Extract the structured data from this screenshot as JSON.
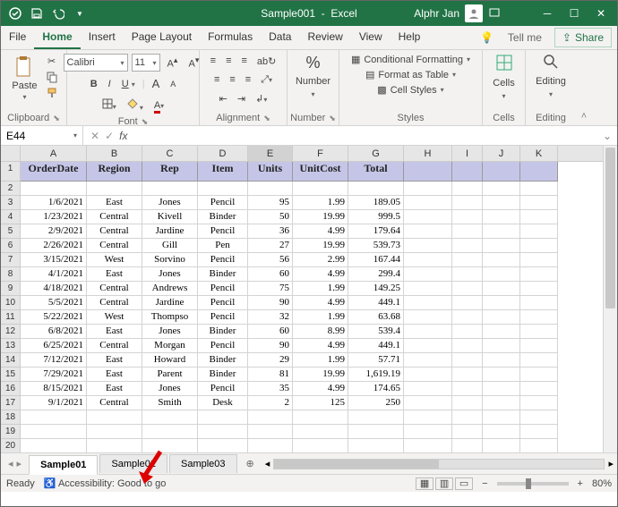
{
  "titlebar": {
    "doc": "Sample001",
    "app": "Excel",
    "user": "Alphr Jan"
  },
  "menu": {
    "file": "File",
    "home": "Home",
    "insert": "Insert",
    "page_layout": "Page Layout",
    "formulas": "Formulas",
    "data": "Data",
    "review": "Review",
    "view": "View",
    "help": "Help",
    "tellme": "Tell me",
    "share": "Share"
  },
  "ribbon": {
    "clipboard": {
      "paste": "Paste",
      "label": "Clipboard"
    },
    "font": {
      "name": "Calibri",
      "size": "11",
      "label": "Font"
    },
    "alignment": {
      "label": "Alignment"
    },
    "number": {
      "btn": "Number",
      "label": "Number"
    },
    "styles": {
      "cond": "Conditional Formatting",
      "table": "Format as Table",
      "cell": "Cell Styles",
      "label": "Styles"
    },
    "cells": {
      "btn": "Cells",
      "label": "Cells"
    },
    "editing": {
      "btn": "Editing",
      "label": "Editing"
    }
  },
  "namebox": "E44",
  "columns": [
    "A",
    "B",
    "C",
    "D",
    "E",
    "F",
    "G",
    "H",
    "I",
    "J",
    "K"
  ],
  "headers": [
    "OrderDate",
    "Region",
    "Rep",
    "Item",
    "Units",
    "UnitCost",
    "Total"
  ],
  "rows": [
    {
      "date": "1/6/2021",
      "region": "East",
      "rep": "Jones",
      "item": "Pencil",
      "units": "95",
      "cost": "1.99",
      "total": "189.05"
    },
    {
      "date": "1/23/2021",
      "region": "Central",
      "rep": "Kivell",
      "item": "Binder",
      "units": "50",
      "cost": "19.99",
      "total": "999.5"
    },
    {
      "date": "2/9/2021",
      "region": "Central",
      "rep": "Jardine",
      "item": "Pencil",
      "units": "36",
      "cost": "4.99",
      "total": "179.64"
    },
    {
      "date": "2/26/2021",
      "region": "Central",
      "rep": "Gill",
      "item": "Pen",
      "units": "27",
      "cost": "19.99",
      "total": "539.73"
    },
    {
      "date": "3/15/2021",
      "region": "West",
      "rep": "Sorvino",
      "item": "Pencil",
      "units": "56",
      "cost": "2.99",
      "total": "167.44"
    },
    {
      "date": "4/1/2021",
      "region": "East",
      "rep": "Jones",
      "item": "Binder",
      "units": "60",
      "cost": "4.99",
      "total": "299.4"
    },
    {
      "date": "4/18/2021",
      "region": "Central",
      "rep": "Andrews",
      "item": "Pencil",
      "units": "75",
      "cost": "1.99",
      "total": "149.25"
    },
    {
      "date": "5/5/2021",
      "region": "Central",
      "rep": "Jardine",
      "item": "Pencil",
      "units": "90",
      "cost": "4.99",
      "total": "449.1"
    },
    {
      "date": "5/22/2021",
      "region": "West",
      "rep": "Thompso",
      "item": "Pencil",
      "units": "32",
      "cost": "1.99",
      "total": "63.68"
    },
    {
      "date": "6/8/2021",
      "region": "East",
      "rep": "Jones",
      "item": "Binder",
      "units": "60",
      "cost": "8.99",
      "total": "539.4"
    },
    {
      "date": "6/25/2021",
      "region": "Central",
      "rep": "Morgan",
      "item": "Pencil",
      "units": "90",
      "cost": "4.99",
      "total": "449.1"
    },
    {
      "date": "7/12/2021",
      "region": "East",
      "rep": "Howard",
      "item": "Binder",
      "units": "29",
      "cost": "1.99",
      "total": "57.71"
    },
    {
      "date": "7/29/2021",
      "region": "East",
      "rep": "Parent",
      "item": "Binder",
      "units": "81",
      "cost": "19.99",
      "total": "1,619.19"
    },
    {
      "date": "8/15/2021",
      "region": "East",
      "rep": "Jones",
      "item": "Pencil",
      "units": "35",
      "cost": "4.99",
      "total": "174.65"
    },
    {
      "date": "9/1/2021",
      "region": "Central",
      "rep": "Smith",
      "item": "Desk",
      "units": "2",
      "cost": "125",
      "total": "250"
    }
  ],
  "sheets": {
    "s1": "Sample01",
    "s2": "Sample02",
    "s3": "Sample03"
  },
  "status": {
    "ready": "Ready",
    "acc": "Accessibility: Good to go",
    "zoom": "80%"
  }
}
